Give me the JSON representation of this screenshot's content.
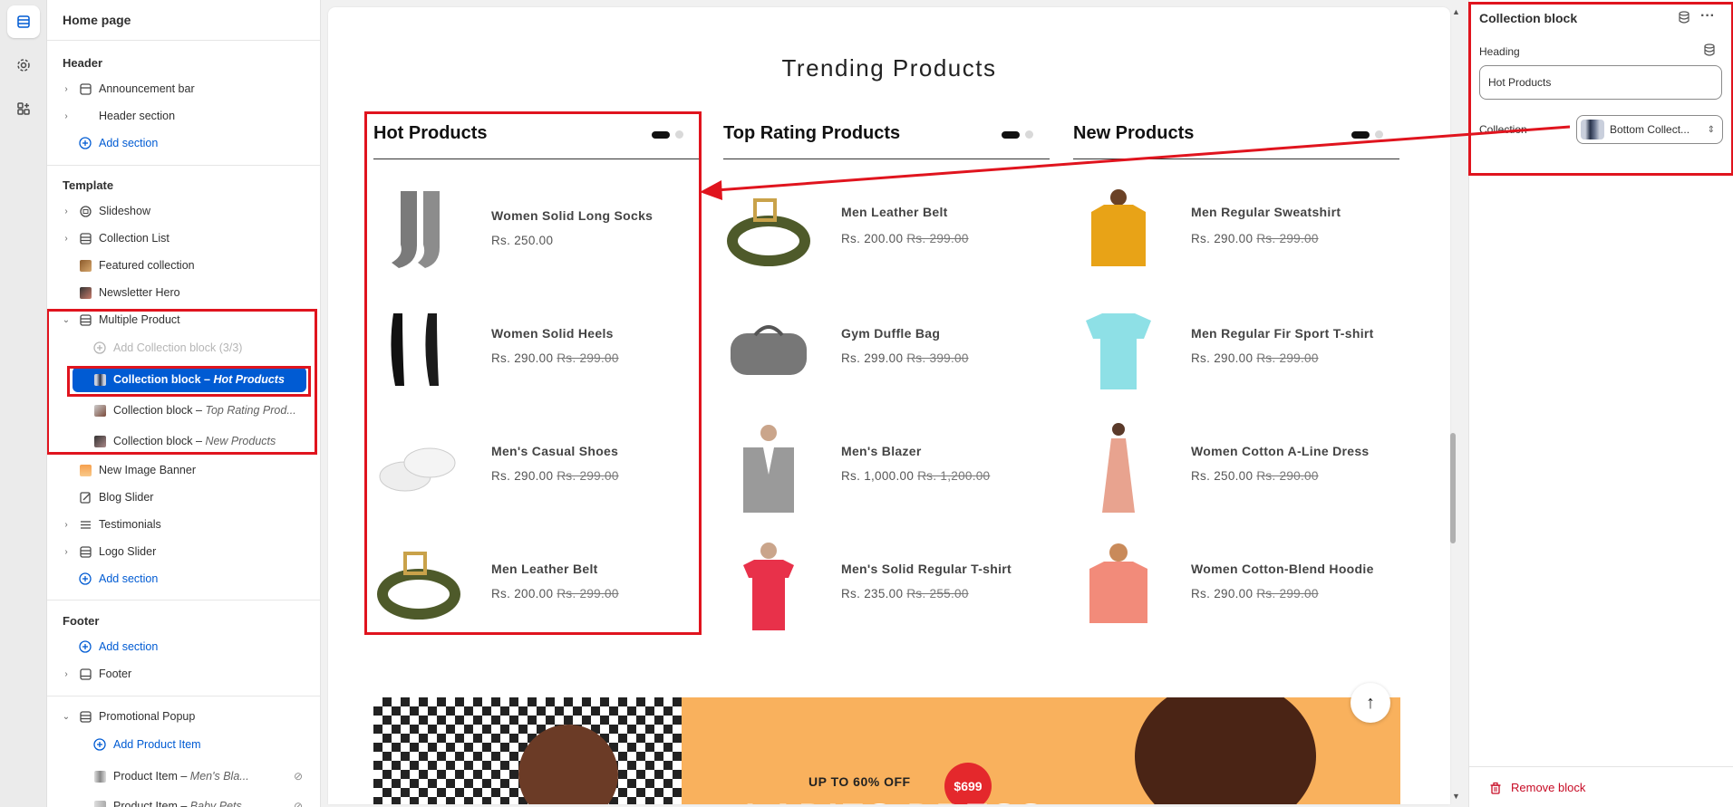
{
  "sidebar": {
    "page_title": "Home page",
    "header_group": "Header",
    "header_items": [
      {
        "label": "Announcement bar"
      },
      {
        "label": "Header section"
      }
    ],
    "add_section": "Add section",
    "template_group": "Template",
    "template_items": [
      {
        "label": "Slideshow"
      },
      {
        "label": "Collection List"
      },
      {
        "label": "Featured collection"
      },
      {
        "label": "Newsletter Hero"
      },
      {
        "label": "Multiple Product"
      }
    ],
    "add_collection_block": "Add Collection block (3/3)",
    "collection_blocks": [
      {
        "label": "Collection block",
        "suffix": "Hot Products"
      },
      {
        "label": "Collection block",
        "suffix": "Top Rating Prod..."
      },
      {
        "label": "Collection block",
        "suffix": "New Products"
      }
    ],
    "more_items": [
      {
        "label": "New Image Banner"
      },
      {
        "label": "Blog Slider"
      },
      {
        "label": "Testimonials"
      },
      {
        "label": "Logo Slider"
      }
    ],
    "footer_group": "Footer",
    "footer_item": "Footer",
    "popup_item": "Promotional Popup",
    "add_product_item": "Add Product Item",
    "product_items": [
      {
        "label": "Product Item",
        "suffix": "Men's Bla..."
      },
      {
        "label": "Product Item",
        "suffix": "Baby Pets"
      }
    ],
    "dash": " – "
  },
  "preview": {
    "section_title": "Trending Products",
    "columns": [
      {
        "title": "Hot Products",
        "products": [
          {
            "name": "Women Solid Long Socks",
            "price": "Rs. 250.00",
            "compare": ""
          },
          {
            "name": "Women Solid Heels",
            "price": "Rs. 290.00",
            "compare": "Rs. 299.00"
          },
          {
            "name": "Men's Casual Shoes",
            "price": "Rs. 290.00",
            "compare": "Rs. 299.00"
          },
          {
            "name": "Men Leather Belt",
            "price": "Rs. 200.00",
            "compare": "Rs. 299.00"
          }
        ]
      },
      {
        "title": "Top Rating Products",
        "products": [
          {
            "name": "Men Leather Belt",
            "price": "Rs. 200.00",
            "compare": "Rs. 299.00"
          },
          {
            "name": "Gym Duffle Bag",
            "price": "Rs. 299.00",
            "compare": "Rs. 399.00"
          },
          {
            "name": "Men's Blazer",
            "price": "Rs. 1,000.00",
            "compare": "Rs. 1,200.00"
          },
          {
            "name": "Men's Solid Regular T-shirt",
            "price": "Rs. 235.00",
            "compare": "Rs. 255.00"
          }
        ]
      },
      {
        "title": "New Products",
        "products": [
          {
            "name": "Men Regular Sweatshirt",
            "price": "Rs. 290.00",
            "compare": "Rs. 299.00"
          },
          {
            "name": "Men Regular Fir Sport T-shirt",
            "price": "Rs. 290.00",
            "compare": "Rs. 299.00"
          },
          {
            "name": "Women Cotton A-Line Dress",
            "price": "Rs. 250.00",
            "compare": "Rs. 290.00"
          },
          {
            "name": "Women Cotton-Blend Hoodie",
            "price": "Rs. 290.00",
            "compare": "Rs. 299.00"
          }
        ]
      }
    ],
    "banner": {
      "offer": "UP TO 60% OFF",
      "badge": "$699",
      "headline": "LADIES DRESS"
    },
    "back_to_top": "↑"
  },
  "panel": {
    "title": "Collection block",
    "heading_label": "Heading",
    "heading_value": "Hot Products",
    "collection_label": "Collection",
    "collection_value": "Bottom Collect...",
    "remove_label": "Remove block"
  },
  "colors": {
    "accent": "#005bd3",
    "highlight": "#e0141e",
    "danger": "#c70a24"
  }
}
